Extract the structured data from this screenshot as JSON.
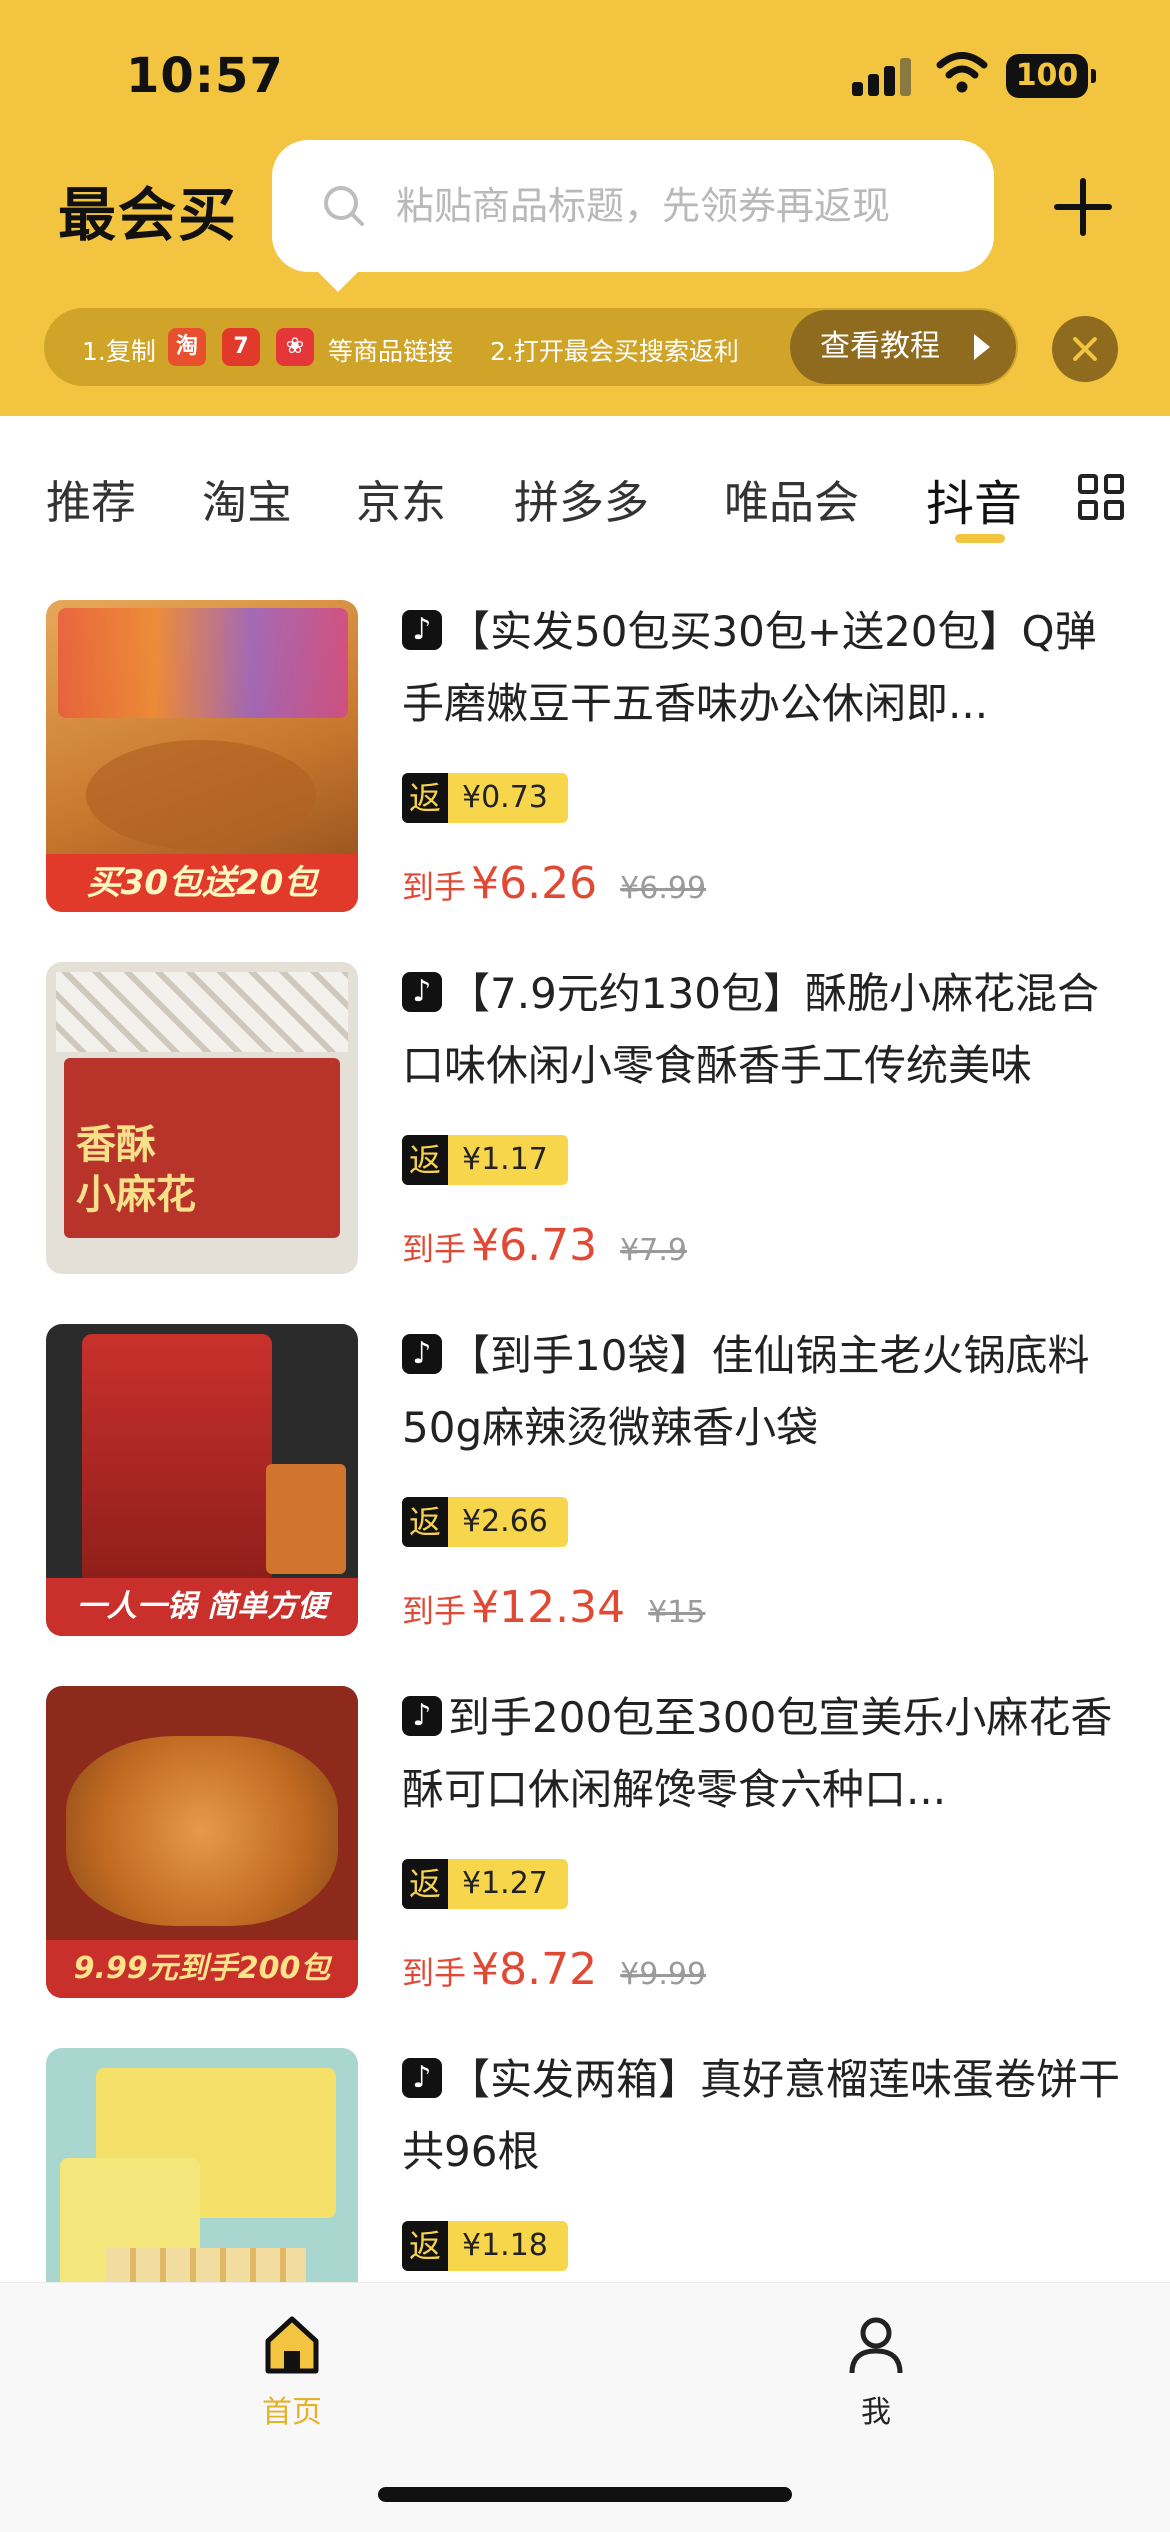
{
  "status": {
    "time": "10:57",
    "battery": "100"
  },
  "header": {
    "logo": "最会买",
    "search_placeholder": "粘贴商品标题，先领券再返现",
    "tip_step1": "1.复制",
    "tip_icons": [
      "淘",
      "7",
      "❀"
    ],
    "tip_step1_suffix": "等商品链接",
    "tip_step2": "2.打开最会买搜索返利",
    "tutorial_label": "查看教程"
  },
  "tabs": [
    {
      "label": "推荐"
    },
    {
      "label": "淘宝"
    },
    {
      "label": "京东"
    },
    {
      "label": "拼多多"
    },
    {
      "label": "唯品会"
    },
    {
      "label": "抖音"
    }
  ],
  "active_tab": "抖音",
  "products": [
    {
      "title": "【实发50包买30包+送20包】Q弹手磨嫩豆干五香味办公休闲即...",
      "rebate_label": "返",
      "rebate": "¥0.73",
      "final_label": "到手",
      "final_price": "¥6.26",
      "original_price": "¥6.99",
      "banner": "买30包送20包",
      "colors": [
        "#c8782e",
        "#e7a85a"
      ]
    },
    {
      "title": "【7.9元约130包】酥脆小麻花混合口味休闲小零食酥香手工传统美味",
      "rebate_label": "返",
      "rebate": "¥1.17",
      "final_label": "到手",
      "final_price": "¥6.73",
      "original_price": "¥7.9",
      "banner": "",
      "colors": [
        "#d9d4cc",
        "#b8342a"
      ]
    },
    {
      "title": "【到手10袋】佳仙锅主老火锅底料50g麻辣烫微辣香小袋",
      "rebate_label": "返",
      "rebate": "¥2.66",
      "final_label": "到手",
      "final_price": "¥12.34",
      "original_price": "¥15",
      "banner": "一人一锅 简单方便",
      "colors": [
        "#2b2b2b",
        "#c9302c"
      ]
    },
    {
      "title": "到手200包至300包宣美乐小麻花香酥可口休闲解馋零食六种口...",
      "rebate_label": "返",
      "rebate": "¥1.27",
      "final_label": "到手",
      "final_price": "¥8.72",
      "original_price": "¥9.99",
      "banner": "9.99元到手200包",
      "colors": [
        "#8e2a1c",
        "#d98a3a"
      ]
    },
    {
      "title": "【实发两箱】真好意榴莲味蛋卷饼干共96根",
      "rebate_label": "返",
      "rebate": "¥1.18",
      "final_label": "到手",
      "final_price": "",
      "original_price": "",
      "banner": "",
      "colors": [
        "#a9d6cf",
        "#f5e06a"
      ]
    }
  ],
  "bottom_nav": [
    {
      "label": "首页",
      "active": true
    },
    {
      "label": "我",
      "active": false
    }
  ],
  "theme": {
    "brand_yellow": "#f2c440",
    "price_red": "#e04a35"
  }
}
